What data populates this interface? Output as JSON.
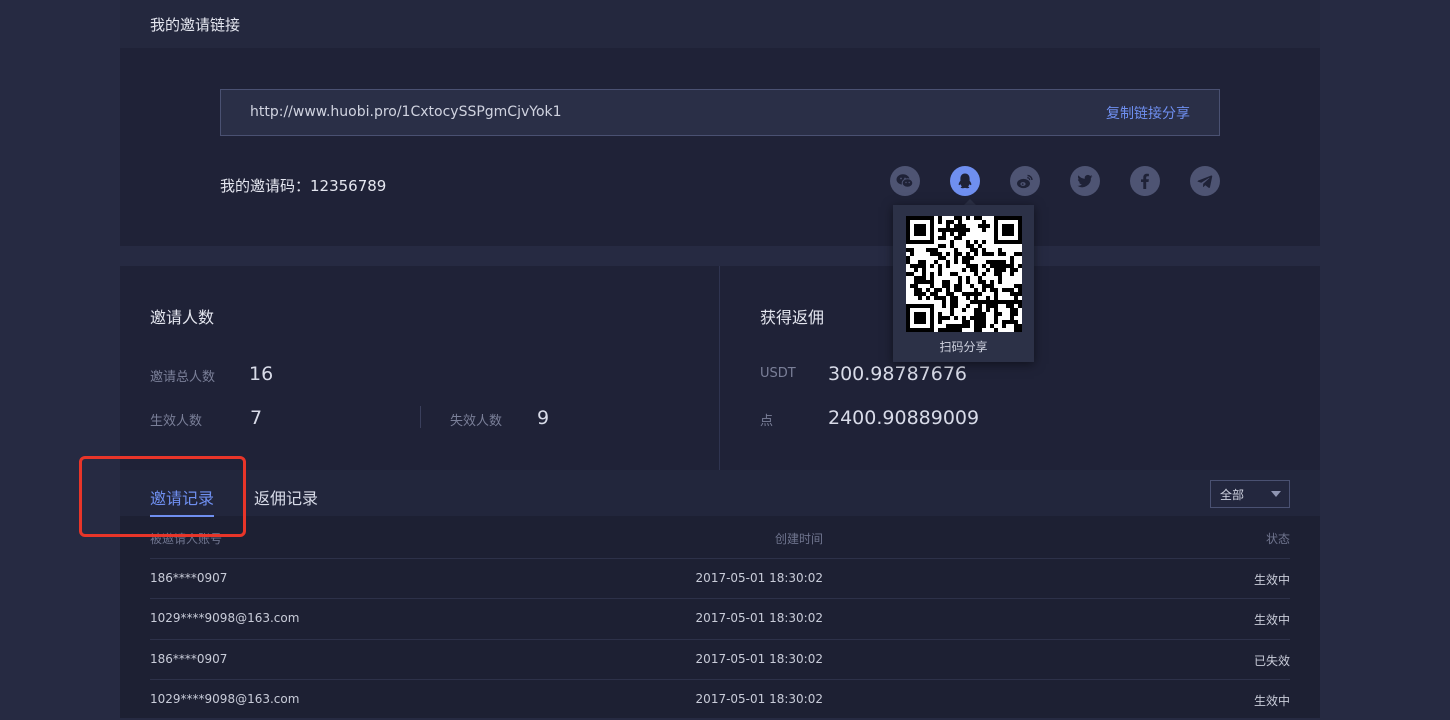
{
  "link_section": {
    "title": "我的邀请链接",
    "url": "http://www.huobi.pro/1CxtocySSPgmCjvYok1",
    "copy_label": "复制链接分享",
    "code_label": "我的邀请码：12356789"
  },
  "share_icons": [
    "wechat-icon",
    "qq-icon",
    "weibo-icon",
    "twitter-icon",
    "facebook-icon",
    "telegram-icon"
  ],
  "qr_popup": {
    "caption": "扫码分享"
  },
  "invite_stats": {
    "title": "邀请人数",
    "total_label": "邀请总人数",
    "total_value": "16",
    "valid_label": "生效人数",
    "valid_value": "7",
    "invalid_label": "失效人数",
    "invalid_value": "9"
  },
  "rebate_stats": {
    "title": "获得返佣",
    "usdt_label": "USDT",
    "usdt_value": "300.98787676",
    "point_label": "点",
    "point_value": "2400.90889009"
  },
  "tabs": {
    "invite": "邀请记录",
    "rebate": "返佣记录"
  },
  "filter": {
    "selected": "全部"
  },
  "table": {
    "columns": [
      "被邀请人账号",
      "创建时间",
      "状态"
    ],
    "rows": [
      {
        "account": "186****0907",
        "time": "2017-05-01  18:30:02",
        "status": "生效中"
      },
      {
        "account": "1029****9098@163.com",
        "time": "2017-05-01  18:30:02",
        "status": "生效中"
      },
      {
        "account": "186****0907",
        "time": "2017-05-01  18:30:02",
        "status": "已失效"
      },
      {
        "account": "1029****9098@163.com",
        "time": "2017-05-01  18:30:02",
        "status": "生效中"
      }
    ]
  },
  "colors": {
    "accent": "#6f8ff0",
    "highlight": "#e83529",
    "background": "#262a42"
  }
}
